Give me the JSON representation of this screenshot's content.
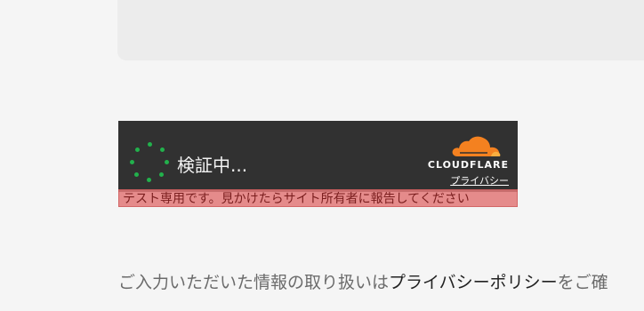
{
  "widget": {
    "status": "検証中...",
    "brand": "CLOUDFLARE",
    "privacy_link": "プライバシー",
    "icons": {
      "spinner": "loading-spinner-icon",
      "logo": "cloudflare-cloud-icon"
    },
    "colors": {
      "background": "#313131",
      "spinner": "#22b14c",
      "cloud": "#f48120"
    }
  },
  "test_banner": {
    "text": "テスト専用です。見かけたらサイト所有者に報告してください",
    "color": "#e27878"
  },
  "footer": {
    "prefix": "ご入力いただいた情報の取り扱いは",
    "link": "プライバシーポリシー",
    "suffix": "をご確"
  }
}
